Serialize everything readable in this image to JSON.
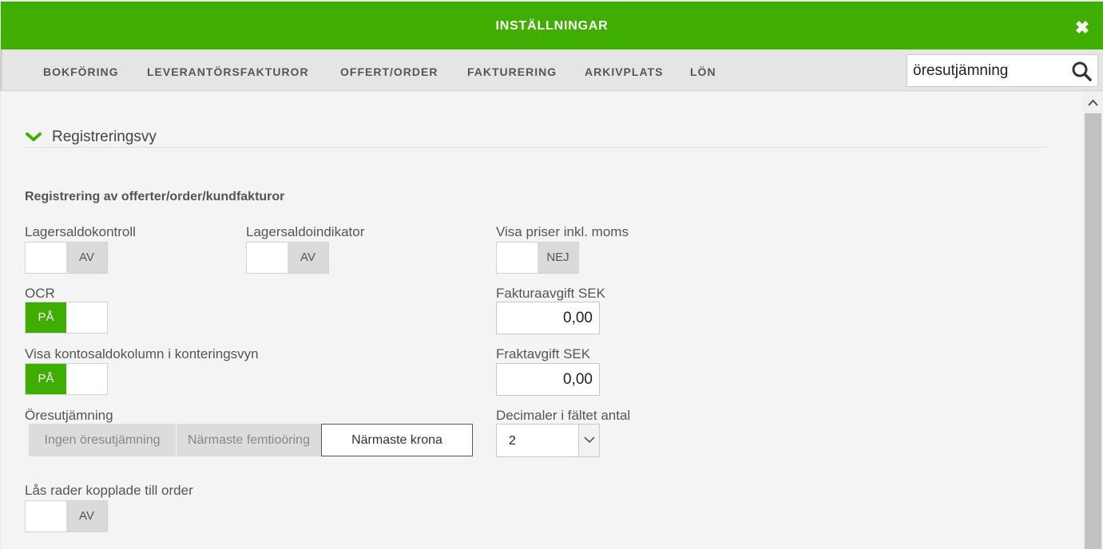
{
  "window": {
    "title": "INSTÄLLNINGAR"
  },
  "nav": {
    "tabs": [
      {
        "label": "BOKFÖRING"
      },
      {
        "label": "LEVERANTÖRSFAKTUROR"
      },
      {
        "label": "OFFERT/ORDER"
      },
      {
        "label": "FAKTURERING"
      },
      {
        "label": "ARKIVPLATS"
      },
      {
        "label": "LÖN"
      }
    ],
    "search": {
      "value": "öresutjämning",
      "icon": "search-icon"
    }
  },
  "colors": {
    "accent": "#3fae00",
    "toggle_off": "#dadada"
  },
  "section": {
    "title": "Registreringsvy",
    "subheading": "Registrering av offerter/order/kundfakturor"
  },
  "fields": {
    "lagersaldokontroll": {
      "label": "Lagersaldokontroll",
      "state": "AV"
    },
    "lagersaldoindikator": {
      "label": "Lagersaldoindikator",
      "state": "AV"
    },
    "visa_priser": {
      "label": "Visa priser inkl. moms",
      "state": "NEJ"
    },
    "ocr": {
      "label": "OCR",
      "state": "PÅ"
    },
    "fakturaavgift": {
      "label": "Fakturaavgift SEK",
      "value": "0,00"
    },
    "visa_kontosaldo": {
      "label": "Visa kontosaldokolumn i konteringsvyn",
      "state": "PÅ"
    },
    "fraktavgift": {
      "label": "Fraktavgift SEK",
      "value": "0,00"
    },
    "oresutjamning": {
      "label": "Öresutjämning",
      "options": [
        "Ingen öresutjämning",
        "Närmaste femtioöring",
        "Närmaste krona"
      ],
      "selected": "Närmaste krona"
    },
    "decimaler": {
      "label": "Decimaler i fältet antal",
      "value": "2"
    },
    "las_rader": {
      "label": "Lås rader kopplade till order",
      "state": "AV"
    }
  }
}
